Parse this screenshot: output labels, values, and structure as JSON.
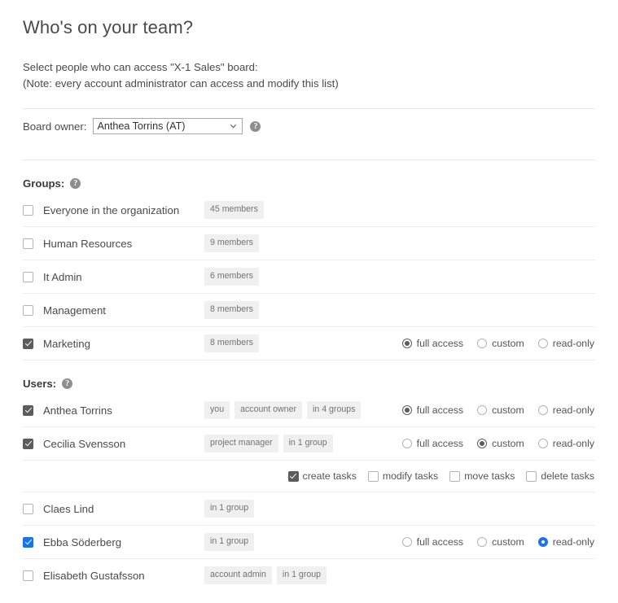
{
  "header": {
    "title": "Who's on your team?",
    "intro_line1": "Select people who can access \"X-1 Sales\" board:",
    "intro_line2": "(Note: every account administrator can access and modify this list)"
  },
  "board_owner": {
    "label": "Board owner:",
    "selected": "Anthea Torrins (AT)",
    "options": [
      "Anthea Torrins (AT)"
    ],
    "help": "?"
  },
  "groups_section": {
    "heading": "Groups:",
    "help": "?",
    "rows": [
      {
        "name": "Everyone in the organization",
        "checked": false,
        "accent": false,
        "badges": [
          "45 members"
        ],
        "show_access": false,
        "access": null
      },
      {
        "name": "Human Resources",
        "checked": false,
        "accent": false,
        "badges": [
          "9 members"
        ],
        "show_access": false,
        "access": null
      },
      {
        "name": "It Admin",
        "checked": false,
        "accent": false,
        "badges": [
          "6 members"
        ],
        "show_access": false,
        "access": null
      },
      {
        "name": "Management",
        "checked": false,
        "accent": false,
        "badges": [
          "8 members"
        ],
        "show_access": false,
        "access": null
      },
      {
        "name": "Marketing",
        "checked": true,
        "accent": false,
        "badges": [
          "8 members"
        ],
        "show_access": true,
        "access": "full access"
      }
    ]
  },
  "users_section": {
    "heading": "Users:",
    "help": "?",
    "rows": [
      {
        "name": "Anthea Torrins",
        "checked": true,
        "accent": false,
        "badges": [
          "you",
          "account owner",
          "in 4 groups"
        ],
        "show_access": true,
        "access": "full access",
        "perms": null
      },
      {
        "name": "Cecilia Svensson",
        "checked": true,
        "accent": false,
        "badges": [
          "project manager",
          "in 1 group"
        ],
        "show_access": true,
        "access": "custom",
        "perms": [
          {
            "label": "create tasks",
            "checked": true
          },
          {
            "label": "modify tasks",
            "checked": false
          },
          {
            "label": "move tasks",
            "checked": false
          },
          {
            "label": "delete tasks",
            "checked": false
          }
        ]
      },
      {
        "name": "Claes Lind",
        "checked": false,
        "accent": false,
        "badges": [
          "in 1 group"
        ],
        "show_access": false,
        "access": null,
        "perms": null
      },
      {
        "name": "Ebba Söderberg",
        "checked": true,
        "accent": true,
        "badges": [
          "in 1 group"
        ],
        "show_access": true,
        "access": "read-only",
        "perms": null
      },
      {
        "name": "Elisabeth Gustafsson",
        "checked": false,
        "accent": false,
        "badges": [
          "account admin",
          "in 1 group"
        ],
        "show_access": false,
        "access": null,
        "perms": null
      }
    ]
  },
  "access_options": [
    "full access",
    "custom",
    "read-only"
  ],
  "colors": {
    "accent": "#1a73e8",
    "control": "#5c5c5c",
    "text": "#4a4a4a",
    "badge_bg": "#f0f0f0",
    "badge_text": "#737373",
    "divider": "#ececec"
  }
}
